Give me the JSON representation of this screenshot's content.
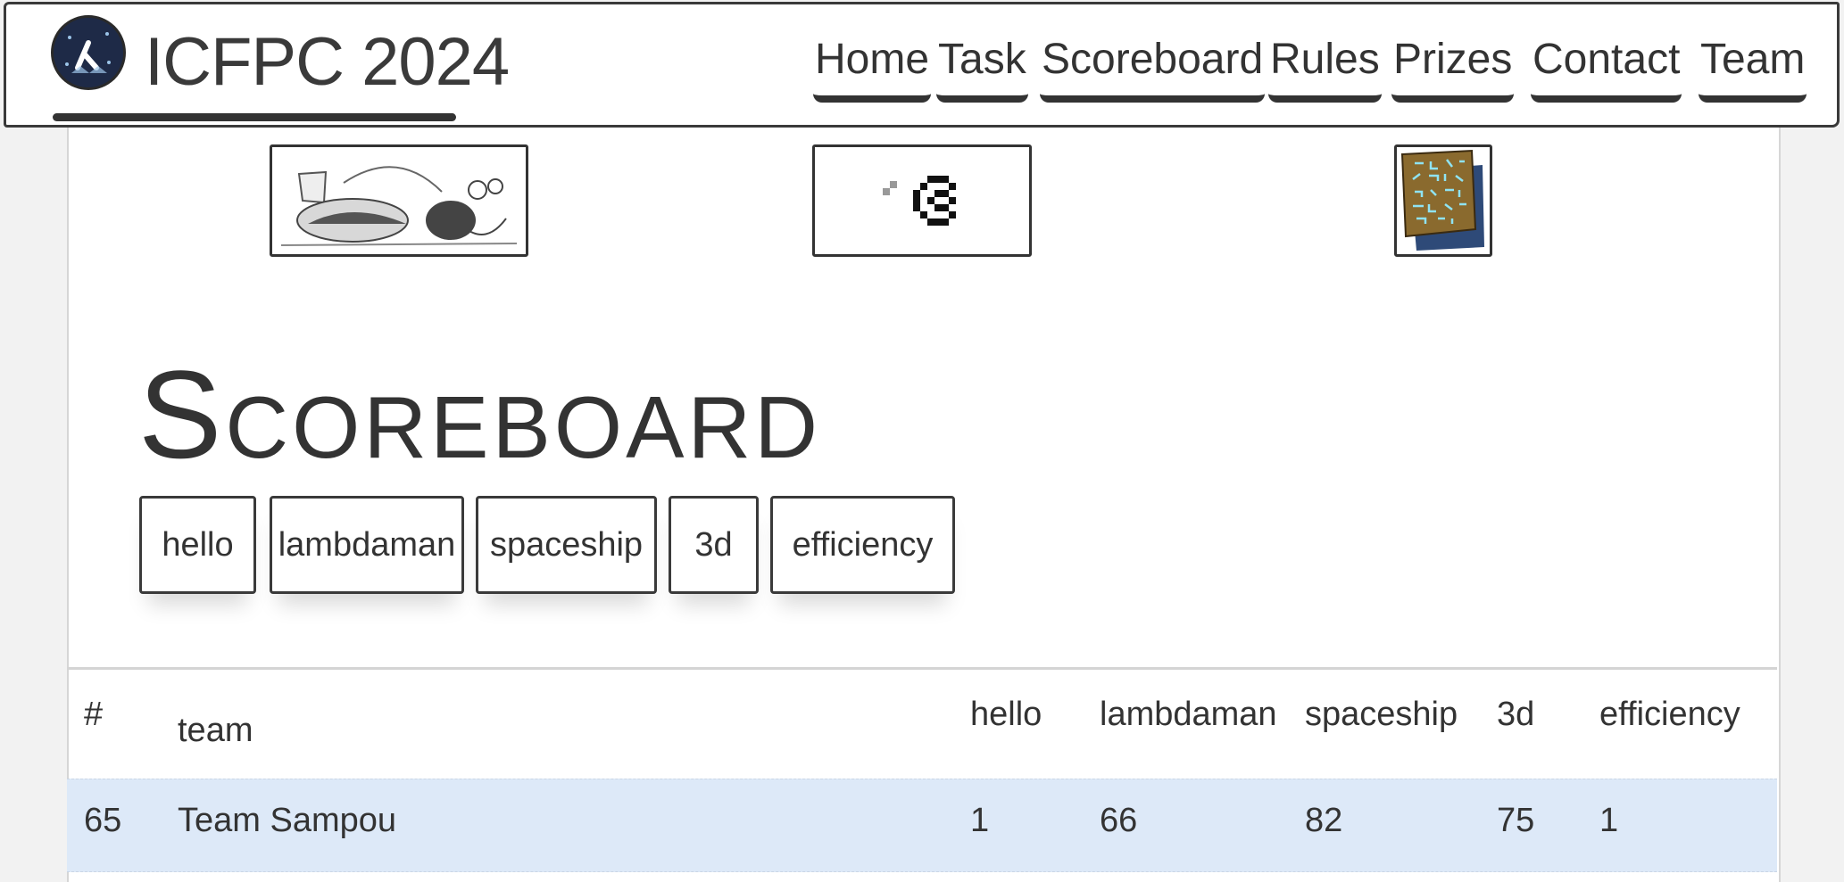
{
  "header": {
    "brand": "ICFPC 2024",
    "nav": [
      "Home",
      "Task",
      "Scoreboard",
      "Rules",
      "Prizes",
      "Contact",
      "Team"
    ]
  },
  "icons": {
    "logo": "lambda-logo-icon",
    "thumb1": "spaceship-comic-image",
    "thumb2": "pixel-glyph-image",
    "thumb3": "alien-tablet-image"
  },
  "main": {
    "title": "Scoreboard",
    "filters": [
      "hello",
      "lambdaman",
      "spaceship",
      "3d",
      "efficiency"
    ]
  },
  "table": {
    "headers": [
      "#",
      "team",
      "hello",
      "lambdaman",
      "spaceship",
      "3d",
      "efficiency"
    ],
    "rows": [
      [
        "65",
        "Team Sampou",
        "1",
        "66",
        "82",
        "75",
        "1"
      ]
    ]
  },
  "colors": {
    "highlight_row": "#dde9f8",
    "ink": "#333333",
    "logo_bg": "#1e2a47"
  }
}
